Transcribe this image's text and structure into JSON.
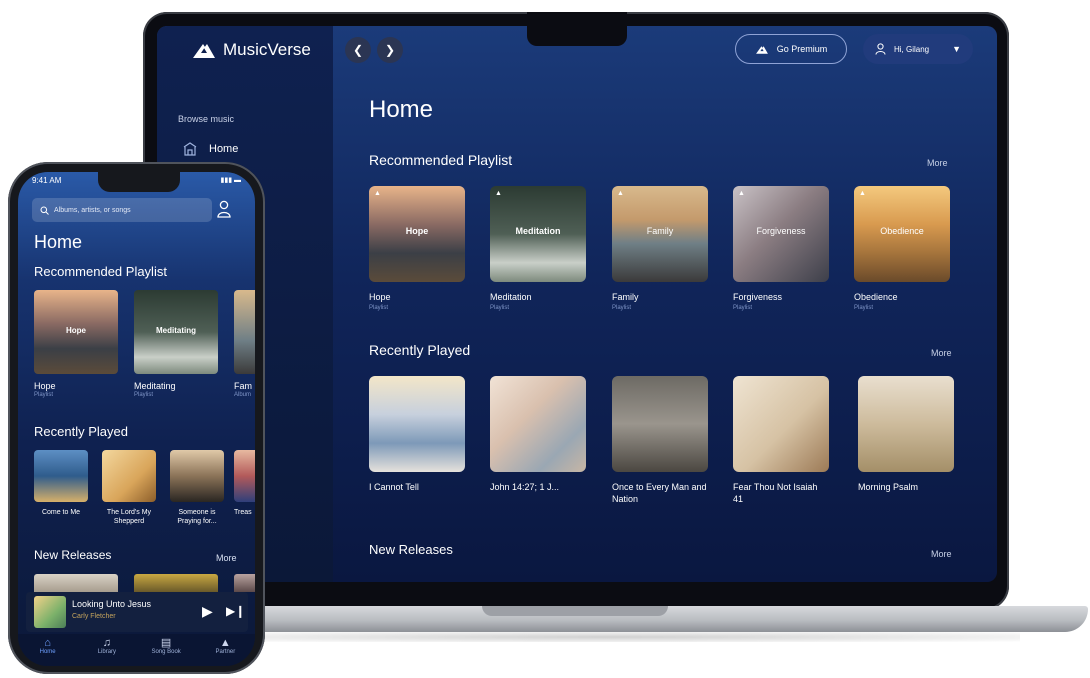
{
  "desktop": {
    "brand": "MusicVerse",
    "premium_label": "Go Premium",
    "user_label": "Hi, Gilang",
    "sidebar": {
      "browse_label": "Browse music",
      "home_label": "Home"
    },
    "page_title": "Home",
    "recommended": {
      "title": "Recommended Playlist",
      "more": "More",
      "items": [
        {
          "name": "Hope",
          "type": "Playlist",
          "overlay": "Hope"
        },
        {
          "name": "Meditation",
          "type": "Playlist",
          "overlay": "Meditation"
        },
        {
          "name": "Family",
          "type": "Playlist",
          "overlay": "Family"
        },
        {
          "name": "Forgiveness",
          "type": "Playlist",
          "overlay": "Forgiveness"
        },
        {
          "name": "Obedience",
          "type": "Playlist",
          "overlay": "Obedience"
        }
      ]
    },
    "recent": {
      "title": "Recently Played",
      "more": "More",
      "items": [
        {
          "name": "I Cannot Tell"
        },
        {
          "name": "John 14:27; 1 J..."
        },
        {
          "name": "Once to Every Man and Nation"
        },
        {
          "name": "Fear Thou Not Isaiah 41"
        },
        {
          "name": "Morning Psalm"
        }
      ]
    },
    "new_releases": {
      "title": "New Releases",
      "more": "More"
    }
  },
  "mobile": {
    "time": "9:41 AM",
    "search_placeholder": "Albums, artists, or songs",
    "page_title": "Home",
    "recommended": {
      "title": "Recommended Playlist",
      "items": [
        {
          "name": "Hope",
          "type": "Playlist",
          "overlay": "Hope"
        },
        {
          "name": "Meditating",
          "type": "Playlist",
          "overlay": "Meditating"
        },
        {
          "name": "Fam",
          "type": "Album"
        }
      ]
    },
    "recent": {
      "title": "Recently Played",
      "items": [
        {
          "name": "Come to Me"
        },
        {
          "name": "The Lord's My Shepperd"
        },
        {
          "name": "Someone is Praying for..."
        },
        {
          "name": "Treas"
        }
      ]
    },
    "new_releases": {
      "title": "New Releases",
      "more": "More"
    },
    "player": {
      "title": "Looking Unto Jesus",
      "artist": "Carly Fletcher"
    },
    "tabs": [
      {
        "label": "Home",
        "icon": "home-icon"
      },
      {
        "label": "Library",
        "icon": "music-note-icon"
      },
      {
        "label": "Song Book",
        "icon": "book-icon"
      },
      {
        "label": "Partner",
        "icon": "partner-logo-icon"
      }
    ]
  }
}
